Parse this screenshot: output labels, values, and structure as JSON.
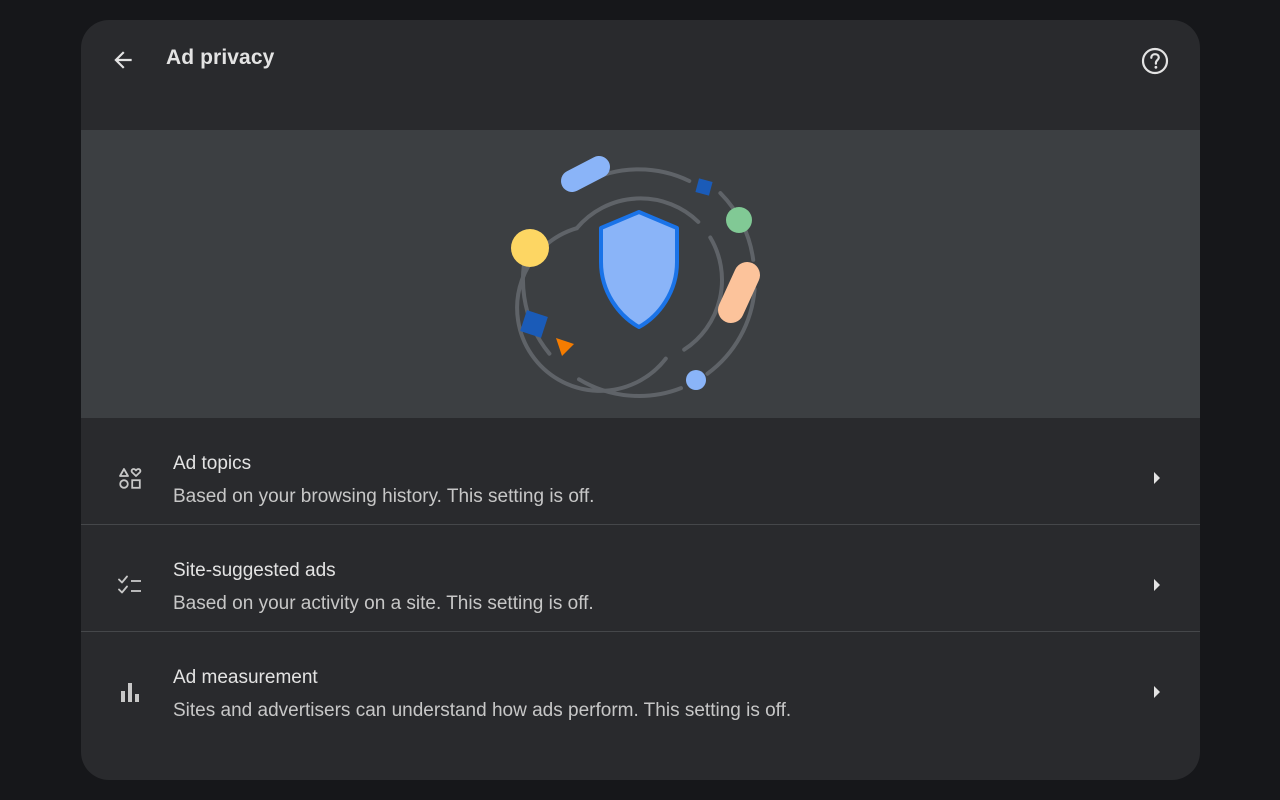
{
  "header": {
    "title": "Ad privacy",
    "back_icon": "arrow-back-icon",
    "help_icon": "help-circle-icon"
  },
  "banner": {
    "illustration": "shield-icon",
    "colors": {
      "background": "#3c3f42",
      "shield": "#8ab4f8",
      "shield_outline": "#1a73e8",
      "yellow": "#fdd663",
      "green": "#81c995",
      "peach": "#fcc39b",
      "blue_dark": "#1a5bb8",
      "orange": "#f57c00",
      "ring": "#5f6368"
    }
  },
  "rows": [
    {
      "title": "Ad topics",
      "description": "Based on your browsing history. This setting is off.",
      "icon": "interests-icon"
    },
    {
      "title": "Site-suggested ads",
      "description": "Based on your activity on a site. This setting is off.",
      "icon": "checklist-icon"
    },
    {
      "title": "Ad measurement",
      "description": "Sites and advertisers can understand how ads perform. This setting is off.",
      "icon": "bar-chart-icon"
    }
  ],
  "colors": {
    "page_background": "#16171a",
    "card_background": "#292a2d",
    "text_primary": "#e3e3e3",
    "text_secondary": "#c7c7c7",
    "divider": "#45474a"
  }
}
